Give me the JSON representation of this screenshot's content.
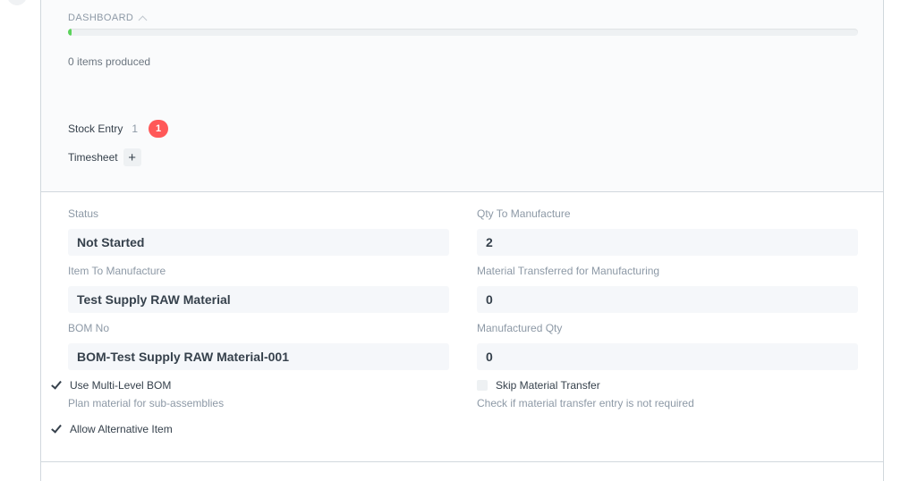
{
  "dashboard": {
    "heading": "DASHBOARD",
    "progress_fraction": 0.005,
    "progress_color": "#5bd35b",
    "items_produced": "0 items produced"
  },
  "connections": {
    "stock_entry": {
      "label": "Stock Entry",
      "count": "1",
      "badge": "1",
      "badge_color": "#ff5858"
    },
    "timesheet": {
      "label": "Timesheet",
      "add_icon": "+"
    }
  },
  "fields": {
    "status": {
      "label": "Status",
      "value": "Not Started"
    },
    "qty_to_manufacture": {
      "label": "Qty To Manufacture",
      "value": "2"
    },
    "item_to_manufacture": {
      "label": "Item To Manufacture",
      "value": "Test Supply RAW Material"
    },
    "material_transferred": {
      "label": "Material Transferred for Manufacturing",
      "value": "0"
    },
    "bom_no": {
      "label": "BOM No",
      "value": "BOM-Test Supply RAW Material-001"
    },
    "manufactured_qty": {
      "label": "Manufactured Qty",
      "value": "0"
    }
  },
  "checks": {
    "use_multi_level_bom": {
      "label": "Use Multi-Level BOM",
      "checked": true,
      "help": "Plan material for sub-assemblies"
    },
    "skip_material_transfer": {
      "label": "Skip Material Transfer",
      "checked": false,
      "help": "Check if material transfer entry is not required"
    },
    "allow_alternative_item": {
      "label": "Allow Alternative Item",
      "checked": true
    }
  }
}
